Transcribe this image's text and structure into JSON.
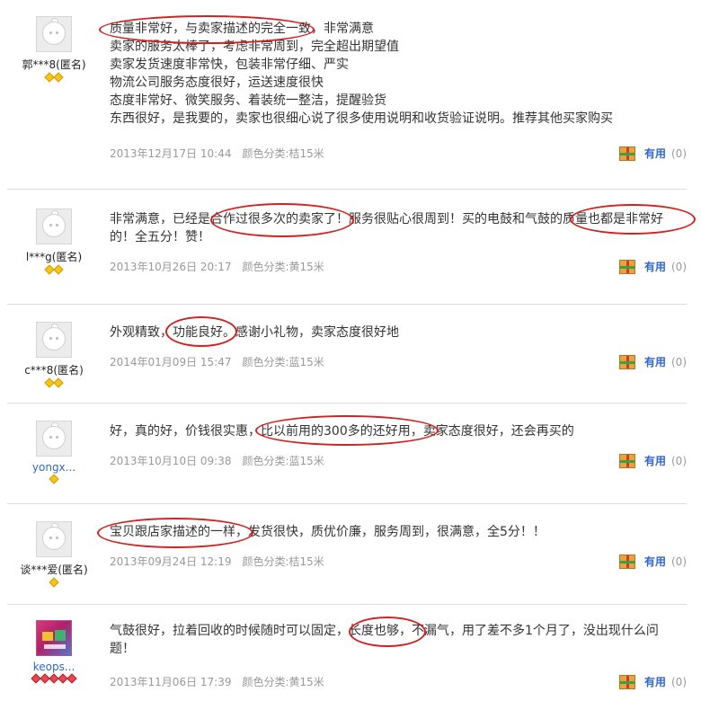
{
  "useful_label": "有用",
  "reviews": [
    {
      "user": "郭***8(匿名)",
      "lines": [
        "质量非常好，与卖家描述的完全一致，非常满意",
        "卖家的服务太棒了，考虑非常周到，完全超出期望值",
        "卖家发货速度非常快，包装非常仔细、严实",
        "物流公司服务态度很好，运送速度很快",
        "态度非常好、微笑服务、着装统一整洁，提醒验货",
        "东西很好，是我要的，卖家也很细心说了很多使用说明和收货验证说明。推荐其他买家购买"
      ],
      "date": "2013年12月17日 10:44",
      "color": "颜色分类:桔15米",
      "useful_count": "(0)"
    },
    {
      "user": "l***g(匿名)",
      "lines": [
        "非常满意，已经是合作过很多次的卖家了！服务很贴心很周到！买的电鼓和气鼓的质量也都是非常好",
        "的！全五分！赞！"
      ],
      "date": "2013年10月26日 20:17",
      "color": "颜色分类:黄15米",
      "useful_count": "(0)"
    },
    {
      "user": "c***8(匿名)",
      "lines": [
        "外观精致，功能良好。感谢小礼物，卖家态度很好地"
      ],
      "date": "2014年01月09日 15:47",
      "color": "颜色分类:蓝15米",
      "useful_count": "(0)"
    },
    {
      "user": "yongx...",
      "lines": [
        "好，真的好，价钱很实惠，比以前用的300多的还好用，卖家态度很好，还会再买的"
      ],
      "date": "2013年10月10日 09:38",
      "color": "颜色分类:蓝15米",
      "useful_count": "(0)"
    },
    {
      "user": "谈***爱(匿名)",
      "lines": [
        "宝贝跟店家描述的一样，发货很快，质优价廉，服务周到，很满意，全5分！！"
      ],
      "date": "2013年09月24日 12:19",
      "color": "颜色分类:桔15米",
      "useful_count": "(0)"
    },
    {
      "user": "keops...",
      "lines": [
        "气鼓很好，拉着回收的时候随时可以固定，长度也够，不漏气，用了差不多1个月了，没出现什么问",
        "题！"
      ],
      "date": "2013年11月06日 17:39",
      "color": "颜色分类:黄15米",
      "useful_count": "(0)"
    }
  ]
}
